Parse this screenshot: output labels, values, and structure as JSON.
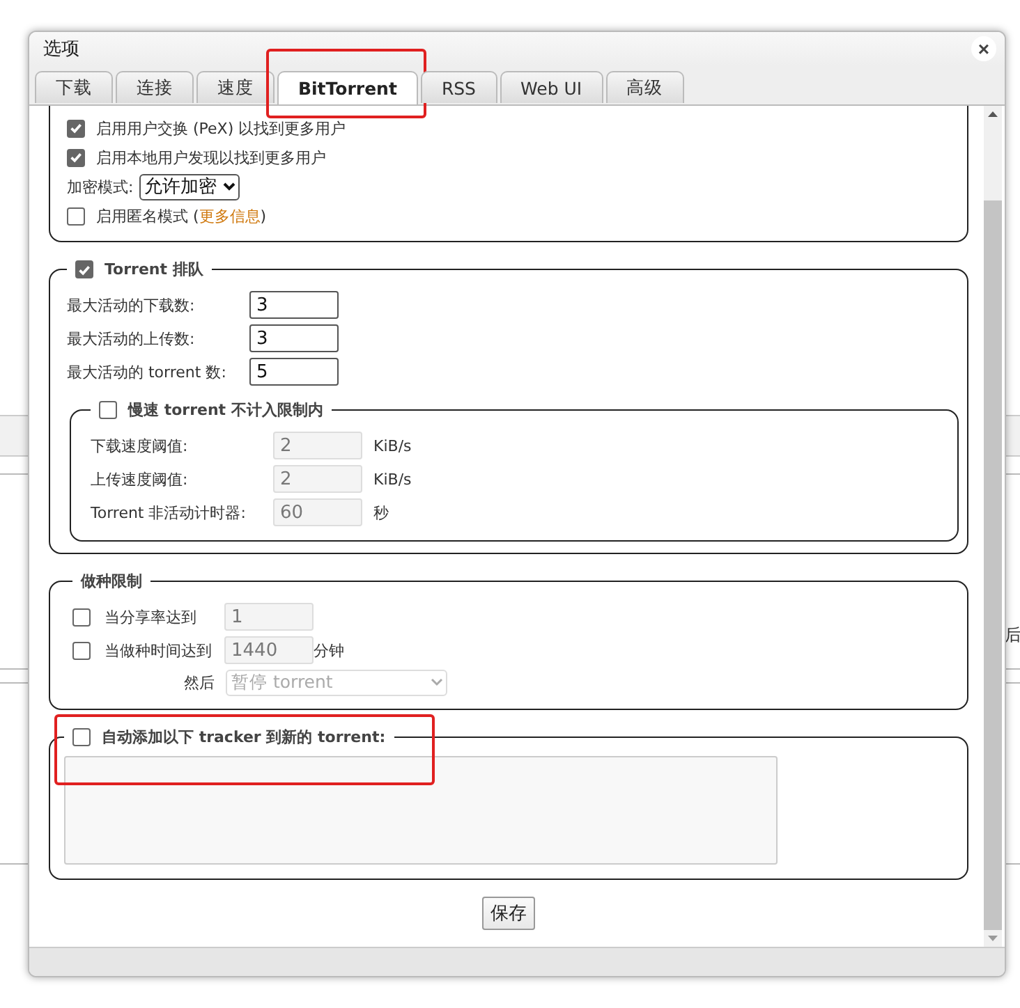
{
  "window": {
    "title": "选项",
    "close": "×"
  },
  "tabs": [
    {
      "label": "下载",
      "selected": false,
      "highlighted": false
    },
    {
      "label": "连接",
      "selected": false,
      "highlighted": false
    },
    {
      "label": "速度",
      "selected": false,
      "highlighted": false
    },
    {
      "label": "BitTorrent",
      "selected": true,
      "highlighted": true
    },
    {
      "label": "RSS",
      "selected": false,
      "highlighted": false
    },
    {
      "label": "Web UI",
      "selected": false,
      "highlighted": false
    },
    {
      "label": "高级",
      "selected": false,
      "highlighted": false
    }
  ],
  "privacy": {
    "options": [
      {
        "label": "启用用户交换 (PeX) 以找到更多用户",
        "checked": true
      },
      {
        "label": "启用本地用户发现以找到更多用户",
        "checked": true
      }
    ],
    "encryption": {
      "label": "加密模式:",
      "value": "允许加密"
    },
    "anonymous": {
      "text_before": "启用匿名模式 (",
      "link": "更多信息",
      "text_after": ")",
      "checked": false
    }
  },
  "queue": {
    "label": "Torrent 排队",
    "checked": true,
    "fields": [
      {
        "label": "最大活动的下载数:",
        "value": "3"
      },
      {
        "label": "最大活动的上传数:",
        "value": "3"
      },
      {
        "label": "最大活动的 torrent 数:",
        "value": "5"
      }
    ],
    "slow": {
      "label": "慢速 torrent 不计入限制内",
      "checked": false,
      "fields": [
        {
          "label": "下载速度阈值:",
          "value": "2",
          "unit": "KiB/s",
          "disabled": true
        },
        {
          "label": "上传速度阈值:",
          "value": "2",
          "unit": "KiB/s",
          "disabled": true
        },
        {
          "label": "Torrent 非活动计时器:",
          "value": "60",
          "unit": "秒",
          "disabled": true
        }
      ]
    }
  },
  "seeding": {
    "title": "做种限制",
    "rows": [
      {
        "label": "当分享率达到",
        "checked": false,
        "value": "1",
        "disabled": true
      },
      {
        "label": "当做种时间达到",
        "checked": false,
        "value": "1440",
        "unit": "分钟",
        "disabled": true
      }
    ],
    "then": {
      "label": "然后",
      "value": "暂停 torrent",
      "disabled": true
    }
  },
  "tracker": {
    "label": "自动添加以下 tracker 到新的 torrent:",
    "checked": false,
    "highlighted": true
  },
  "save_button": "保存",
  "background_text": "后"
}
